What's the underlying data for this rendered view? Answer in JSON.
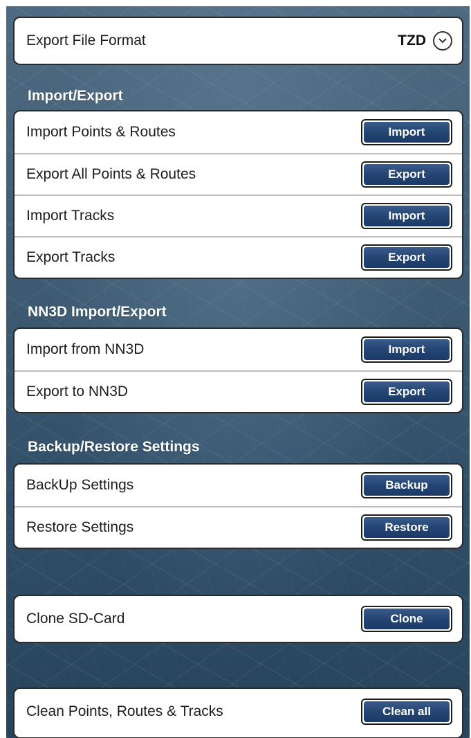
{
  "export_format": {
    "label": "Export File Format",
    "value": "TZD"
  },
  "import_export": {
    "title": "Import/Export",
    "rows": [
      {
        "label": "Import Points & Routes",
        "button": "Import"
      },
      {
        "label": "Export All Points & Routes",
        "button": "Export"
      },
      {
        "label": "Import Tracks",
        "button": "Import"
      },
      {
        "label": "Export Tracks",
        "button": "Export"
      }
    ]
  },
  "nn3d": {
    "title": "NN3D Import/Export",
    "rows": [
      {
        "label": "Import from NN3D",
        "button": "Import"
      },
      {
        "label": "Export to NN3D",
        "button": "Export"
      }
    ]
  },
  "backup": {
    "title": "Backup/Restore Settings",
    "rows": [
      {
        "label": "BackUp Settings",
        "button": "Backup"
      },
      {
        "label": "Restore Settings",
        "button": "Restore"
      }
    ]
  },
  "clone": {
    "label": "Clone SD-Card",
    "button": "Clone"
  },
  "clean": {
    "label": "Clean Points, Routes & Tracks",
    "button": "Clean all"
  },
  "icons": {
    "dropdown": "chevron-down-icon"
  },
  "colors": {
    "button_fill": "#244573",
    "panel_bg": "#ffffff",
    "background": "#3f5c74"
  }
}
